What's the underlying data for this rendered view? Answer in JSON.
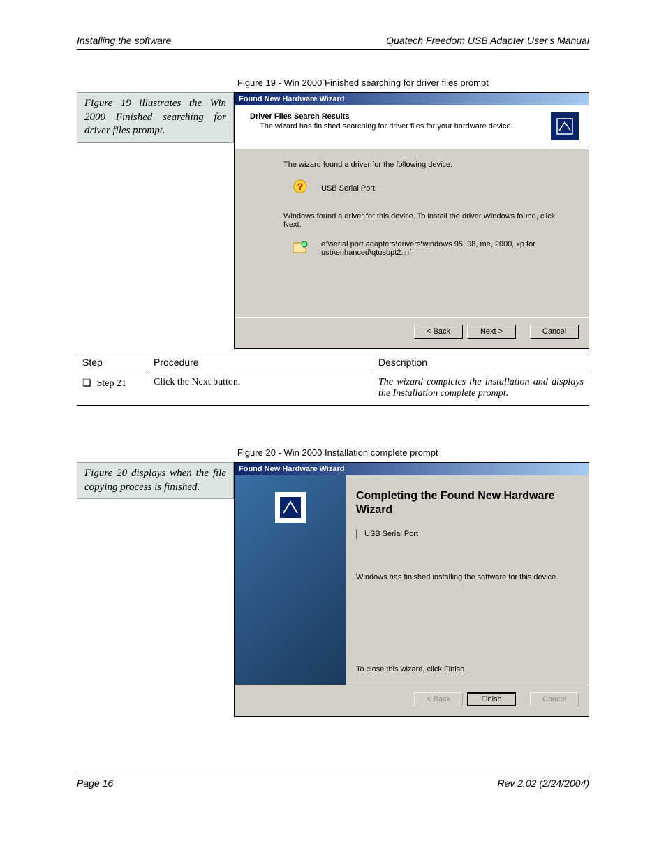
{
  "header": {
    "left": "Installing the software",
    "right": "Quatech Freedom USB Adapter User's Manual"
  },
  "fig19": {
    "caption": "Figure 19 - Win 2000 Finished searching for driver files prompt",
    "margin_note": "Figure 19 illustrates the Win 2000 Finished searching for driver files prompt.",
    "title": "Found New Hardware Wizard",
    "heading_bold": "Driver Files Search Results",
    "heading_sub": "The wizard has finished searching for driver files for your hardware device.",
    "body1": "The wizard found a driver for the following device:",
    "device": "USB Serial Port",
    "body2": "Windows found a driver for this device. To install the driver Windows found, click Next.",
    "inf_path": "e:\\serial port adapters\\drivers\\windows 95, 98, me, 2000, xp for usb\\enhanced\\qtusbpt2.inf",
    "back": "< Back",
    "next": "Next >",
    "cancel": "Cancel"
  },
  "step_table": {
    "headers": {
      "step": "Step",
      "proc": "Procedure",
      "desc": "Description"
    },
    "row": {
      "num_label": "Step 21",
      "proc": "Click the Next button.",
      "desc": "The wizard completes the installation and displays the Installation complete prompt."
    }
  },
  "fig20": {
    "caption": "Figure 20 - Win 2000 Installation complete prompt",
    "margin_note": "Figure 20 displays when the file copying process is finished.",
    "title": "Found New Hardware Wizard",
    "heading": "Completing the Found New Hardware Wizard",
    "device": "USB Serial Port",
    "body": "Windows has finished installing the software for this device.",
    "close_hint": "To close this wizard, click Finish.",
    "back": "< Back",
    "finish": "Finish",
    "cancel": "Cancel"
  },
  "footer": {
    "left": "Page 16",
    "right": "Rev 2.02  (2/24/2004)"
  }
}
